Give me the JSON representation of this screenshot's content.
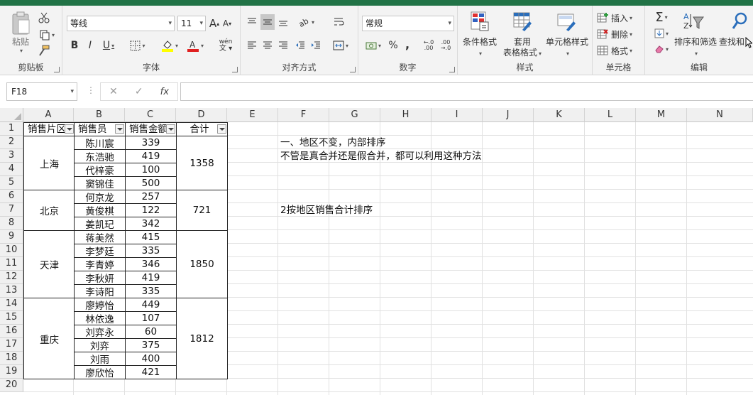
{
  "ribbon": {
    "clipboard": {
      "paste": "粘贴",
      "label": "剪贴板"
    },
    "font": {
      "name": "等线",
      "size": "11",
      "grow": "A",
      "shrink": "A",
      "bold": "B",
      "italic": "I",
      "underline": "U",
      "phonetic": "wén",
      "label": "字体"
    },
    "alignment": {
      "label": "对齐方式"
    },
    "number": {
      "format": "常规",
      "percent": "%",
      "comma": ",",
      "label": "数字"
    },
    "styles": {
      "conditional": "条件格式",
      "table_line1": "套用",
      "table_line2": "表格格式",
      "cell_styles": "单元格样式",
      "label": "样式"
    },
    "cells": {
      "insert": "插入",
      "delete": "删除",
      "format": "格式",
      "label": "单元格"
    },
    "editing": {
      "sum": "Σ",
      "sort": "排序和筛选",
      "find": "查找和",
      "label": "编辑"
    }
  },
  "formula_bar": {
    "name_box": "F18",
    "fx": "fx",
    "cancel": "✕",
    "confirm": "✓"
  },
  "columns": [
    "A",
    "B",
    "C",
    "D",
    "E",
    "F",
    "G",
    "H",
    "I",
    "J",
    "K",
    "L",
    "M",
    "N"
  ],
  "rows": [
    "1",
    "2",
    "3",
    "4",
    "5",
    "6",
    "7",
    "8",
    "9",
    "10",
    "11",
    "12",
    "13",
    "14",
    "15",
    "16",
    "17",
    "18",
    "19",
    "20"
  ],
  "table": {
    "headers": [
      "销售片区",
      "销售员",
      "销售金额",
      "合计"
    ],
    "groups": [
      {
        "region": "上海",
        "total": "1358",
        "people": [
          {
            "name": "陈川宸",
            "amount": "339"
          },
          {
            "name": "东浩驰",
            "amount": "419"
          },
          {
            "name": "代梓豪",
            "amount": "100"
          },
          {
            "name": "窦锦佳",
            "amount": "500"
          }
        ]
      },
      {
        "region": "北京",
        "total": "721",
        "people": [
          {
            "name": "何京龙",
            "amount": "257"
          },
          {
            "name": "黄俊棋",
            "amount": "122"
          },
          {
            "name": "姜凯玘",
            "amount": "342"
          }
        ]
      },
      {
        "region": "天津",
        "total": "1850",
        "people": [
          {
            "name": "蒋美然",
            "amount": "415"
          },
          {
            "name": "李梦廷",
            "amount": "335"
          },
          {
            "name": "李青婷",
            "amount": "346"
          },
          {
            "name": "李秋妍",
            "amount": "419"
          },
          {
            "name": "李诗阳",
            "amount": "335"
          }
        ]
      },
      {
        "region": "重庆",
        "total": "1812",
        "people": [
          {
            "name": "廖婷怡",
            "amount": "449"
          },
          {
            "name": "林依逸",
            "amount": "107"
          },
          {
            "name": "刘弈永",
            "amount": "60"
          },
          {
            "name": "刘弈",
            "amount": "375"
          },
          {
            "name": "刘雨",
            "amount": "400"
          },
          {
            "name": "廖欣怡",
            "amount": "421"
          }
        ]
      }
    ]
  },
  "notes": {
    "line1": "一、地区不变，内部排序",
    "line2": "不管是真合并还是假合并，都可以利用这种方法",
    "line3": "2按地区销售合计排序"
  }
}
